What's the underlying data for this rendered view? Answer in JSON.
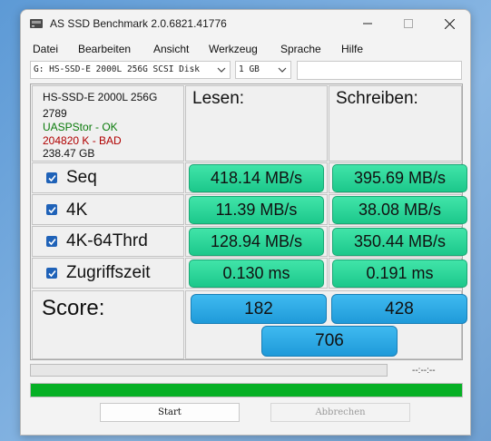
{
  "window": {
    "title": "AS SSD Benchmark 2.0.6821.41776"
  },
  "menu": [
    "Datei",
    "Bearbeiten",
    "Ansicht",
    "Werkzeug",
    "Sprache",
    "Hilfe"
  ],
  "drive_select": {
    "value": "G: HS-SSD-E 2000L 256G SCSI Disk"
  },
  "size_select": {
    "value": "1 GB"
  },
  "drive_info": {
    "model": "HS-SSD-E 2000L 256G",
    "firmware": "2789",
    "driver": "UASPStor - OK",
    "alignment": "204820 K - BAD",
    "capacity": "238.47 GB",
    "driver_color": "#0a7a0a",
    "alignment_color": "#b00000"
  },
  "headers": {
    "read": "Lesen:",
    "write": "Schreiben:"
  },
  "tests": [
    {
      "label": "Seq",
      "checked": true,
      "read": "418.14 MB/s",
      "write": "395.69 MB/s"
    },
    {
      "label": "4K",
      "checked": true,
      "read": "11.39 MB/s",
      "write": "38.08 MB/s"
    },
    {
      "label": "4K-64Thrd",
      "checked": true,
      "read": "128.94 MB/s",
      "write": "350.44 MB/s"
    },
    {
      "label": "Zugriffszeit",
      "checked": true,
      "read": "0.130 ms",
      "write": "0.191 ms"
    }
  ],
  "score": {
    "label": "Score:",
    "read": "182",
    "write": "428",
    "total": "706"
  },
  "progress": {
    "time": "--:--:--",
    "test_progress": 0,
    "overall_progress": 1.0
  },
  "buttons": {
    "start": "Start",
    "abort": "Abbrechen"
  },
  "colors": {
    "result_green": "#29d99b",
    "score_blue": "#2aa6e3",
    "progress_green": "#06b025"
  }
}
